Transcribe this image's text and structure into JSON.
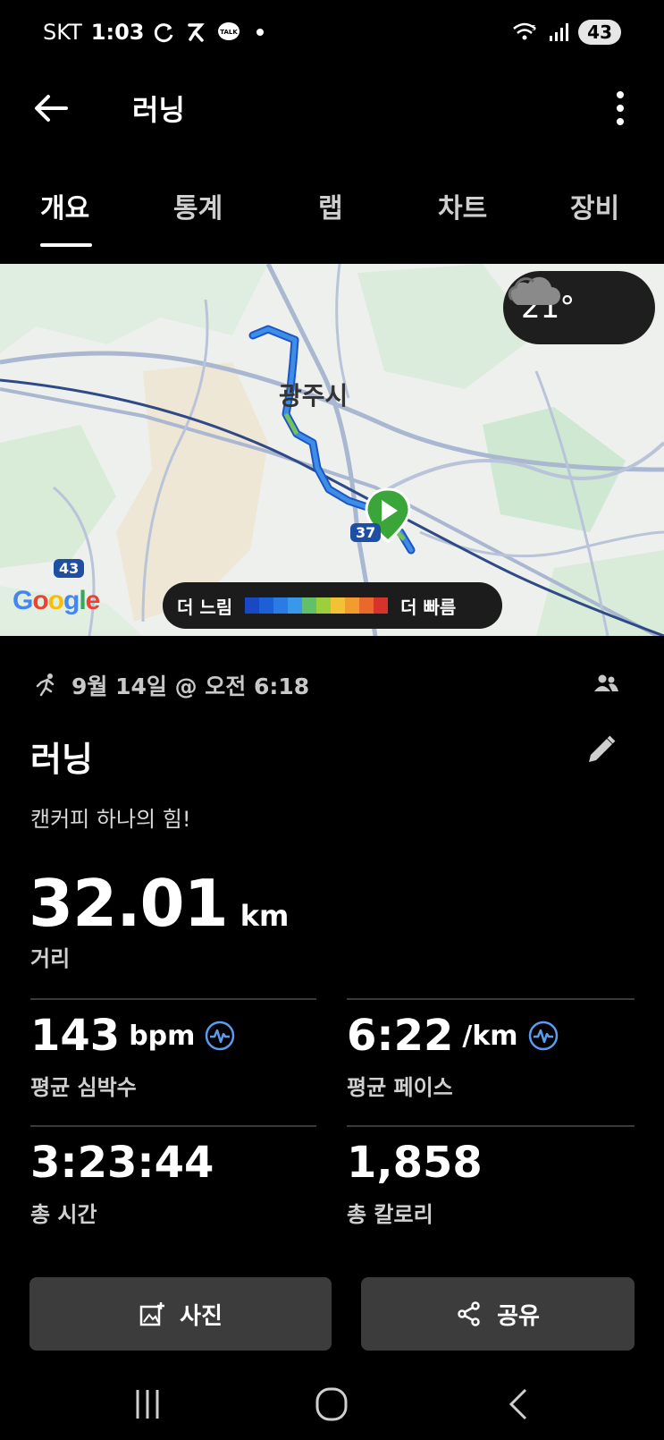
{
  "status_bar": {
    "carrier": "SKT",
    "time": "1:03",
    "battery": "43",
    "icons": [
      "sync-icon",
      "runner-app-icon",
      "talk-icon",
      "wifi-icon",
      "signal-icon"
    ]
  },
  "app_bar": {
    "title": "러닝"
  },
  "tabs": [
    {
      "label": "개요",
      "active": true
    },
    {
      "label": "통계",
      "active": false
    },
    {
      "label": "랩",
      "active": false
    },
    {
      "label": "차트",
      "active": false
    },
    {
      "label": "장비",
      "active": false
    }
  ],
  "map": {
    "city_label": "광주시",
    "temperature": "21°",
    "weather_icon": "cloud-icon",
    "legend_slow": "더 느림",
    "legend_fast": "더 빠름",
    "legend_colors": [
      "#1a48c4",
      "#1d5fd6",
      "#2a7be3",
      "#3a98ea",
      "#62c06b",
      "#9bcf3c",
      "#f1c232",
      "#f29b2f",
      "#e8692a",
      "#d6332a"
    ],
    "road_numbers": [
      "37",
      "43"
    ],
    "provider": "Google"
  },
  "activity": {
    "date": "9월 14일 @ 오전 6:18",
    "title": "러닝",
    "description": "캔커피 하나의 힘!",
    "distance": {
      "value": "32.01",
      "unit": "km",
      "label": "거리"
    },
    "stats": [
      {
        "value": "143",
        "unit": "bpm",
        "label": "평균 심박수",
        "has_icon": true
      },
      {
        "value": "6:22",
        "unit": "/km",
        "label": "평균 페이스",
        "has_icon": true
      },
      {
        "value": "3:23:44",
        "unit": "",
        "label": "총 시간",
        "has_icon": false
      },
      {
        "value": "1,858",
        "unit": "",
        "label": "총 칼로리",
        "has_icon": false
      }
    ]
  },
  "buttons": {
    "photo": "사진",
    "share": "공유"
  }
}
